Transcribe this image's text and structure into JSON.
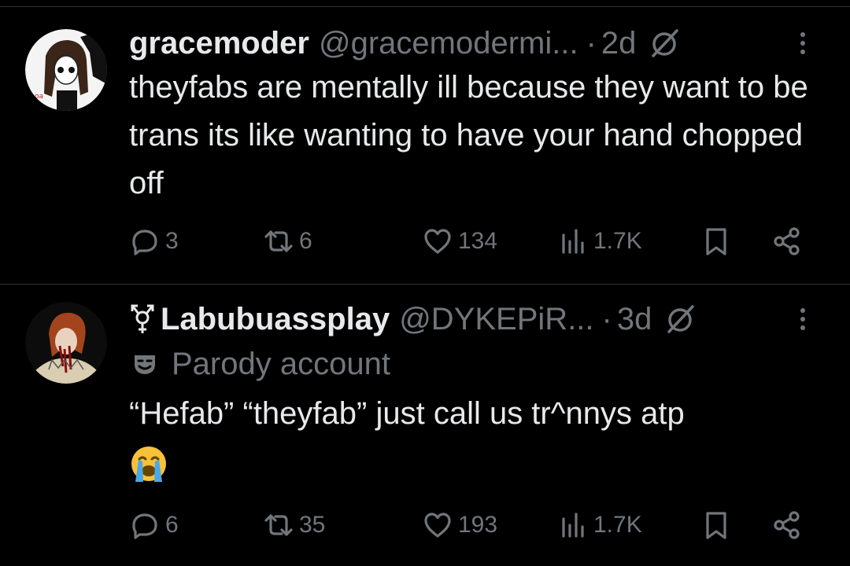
{
  "tweets": [
    {
      "display_name": "gracemoder",
      "handle": "@gracemodermi...",
      "separator": "·",
      "time": "2d",
      "text": "theyfabs are mentally ill because they want to be trans its like wanting to have your hand chopped off",
      "stats": {
        "replies": "3",
        "retweets": "6",
        "likes": "134",
        "views": "1.7K"
      }
    },
    {
      "display_name": "Labubuassplay",
      "handle": "@DYKEPiR...",
      "separator": "·",
      "time": "3d",
      "parody_label": "Parody account",
      "text": "“Hefab” “theyfab” just call us tr^nnys atp",
      "emoji": "loudly-crying-face",
      "stats": {
        "replies": "6",
        "retweets": "35",
        "likes": "193",
        "views": "1.7K"
      }
    }
  ],
  "colors": {
    "background": "#000000",
    "text": "#e7e9ea",
    "muted": "#71767b",
    "divider": "#2f3336"
  },
  "icons": [
    "grok-icon",
    "more-icon",
    "reply-icon",
    "retweet-icon",
    "like-icon",
    "views-icon",
    "bookmark-icon",
    "share-icon",
    "transgender-symbol-icon",
    "parody-mask-icon"
  ]
}
